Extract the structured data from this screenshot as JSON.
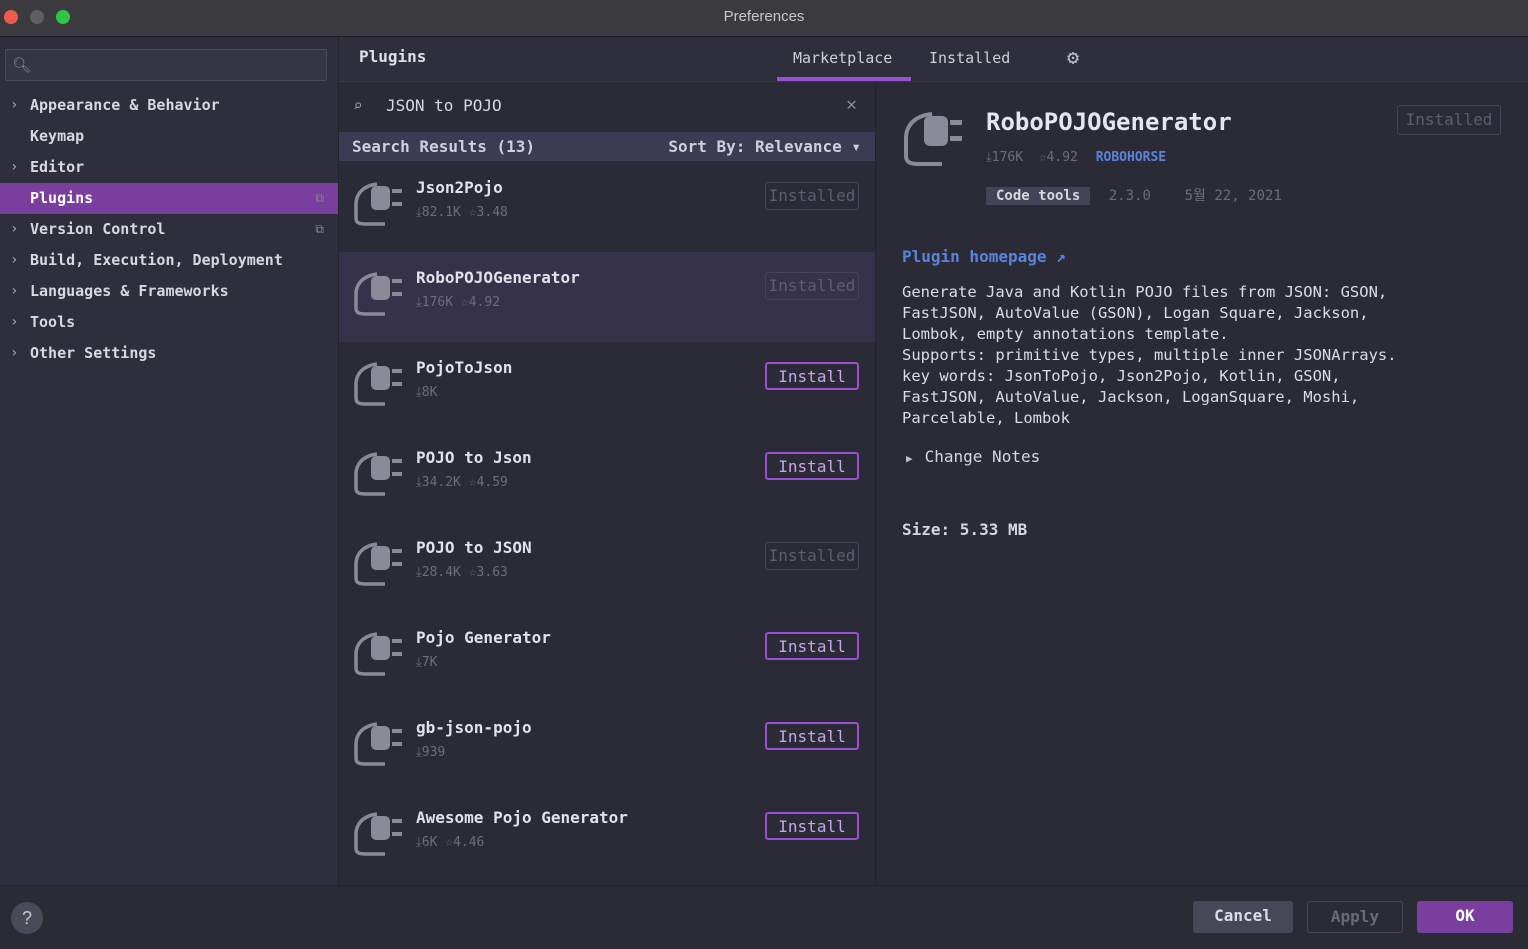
{
  "window": {
    "title": "Preferences"
  },
  "sidebar": {
    "search_placeholder": "",
    "items": [
      {
        "label": "Appearance & Behavior",
        "chevron": true
      },
      {
        "label": "Keymap",
        "chevron": false
      },
      {
        "label": "Editor",
        "chevron": true
      },
      {
        "label": "Plugins",
        "chevron": false,
        "selected": true
      },
      {
        "label": "Version Control",
        "chevron": true
      },
      {
        "label": "Build, Execution, Deployment",
        "chevron": true
      },
      {
        "label": "Languages & Frameworks",
        "chevron": true
      },
      {
        "label": "Tools",
        "chevron": true
      },
      {
        "label": "Other Settings",
        "chevron": true
      }
    ]
  },
  "header": {
    "title": "Plugins",
    "tabs": [
      "Marketplace",
      "Installed"
    ],
    "active_tab": "Marketplace"
  },
  "search": {
    "value": "JSON to POJO"
  },
  "results": {
    "count_label": "Search Results (13)",
    "sort_label": "Sort By: Relevance ▾"
  },
  "plugins": [
    {
      "name": "Json2Pojo",
      "downloads": "82.1K",
      "rating": "3.48",
      "button": "Installed",
      "state": "installed"
    },
    {
      "name": "RoboPOJOGenerator",
      "downloads": "176K",
      "rating": "4.92",
      "button": "Installed",
      "state": "installed",
      "selected": true
    },
    {
      "name": "PojoToJson",
      "downloads": "8K",
      "rating": "",
      "button": "Install",
      "state": "install"
    },
    {
      "name": "POJO to Json",
      "downloads": "34.2K",
      "rating": "4.59",
      "button": "Install",
      "state": "install"
    },
    {
      "name": "POJO to JSON",
      "downloads": "28.4K",
      "rating": "3.63",
      "button": "Installed",
      "state": "installed"
    },
    {
      "name": "Pojo Generator",
      "downloads": "7K",
      "rating": "",
      "button": "Install",
      "state": "install"
    },
    {
      "name": "gb-json-pojo",
      "downloads": "939",
      "rating": "",
      "button": "Install",
      "state": "install"
    },
    {
      "name": "Awesome Pojo Generator",
      "downloads": "6K",
      "rating": "4.46",
      "button": "Install",
      "state": "install"
    }
  ],
  "detail": {
    "name": "RoboPOJOGenerator",
    "button": "Installed",
    "downloads": "176K",
    "rating": "4.92",
    "vendor": "ROBOHORSE",
    "tag": "Code tools",
    "version": "2.3.0",
    "date": "5월 22, 2021",
    "homepage_label": "Plugin homepage ↗",
    "description_lines": [
      "Generate Java and Kotlin POJO files from JSON: GSON,",
      "FastJSON, AutoValue (GSON), Logan Square, Jackson,",
      "Lombok, empty annotations template.",
      "Supports: primitive types, multiple inner JSONArrays.",
      "key words: JsonToPojo, Json2Pojo, Kotlin, GSON,",
      "FastJSON, AutoValue, Jackson, LoganSquare, Moshi,",
      "Parcelable, Lombok"
    ],
    "change_notes_label": "Change Notes",
    "size_label": "Size: 5.33 MB"
  },
  "footer": {
    "help_label": "?",
    "cancel_label": "Cancel",
    "apply_label": "Apply",
    "ok_label": "OK"
  },
  "colors": {
    "accent": "#7a3e9e",
    "link": "#5b83dc",
    "background": "#2b2b38"
  }
}
